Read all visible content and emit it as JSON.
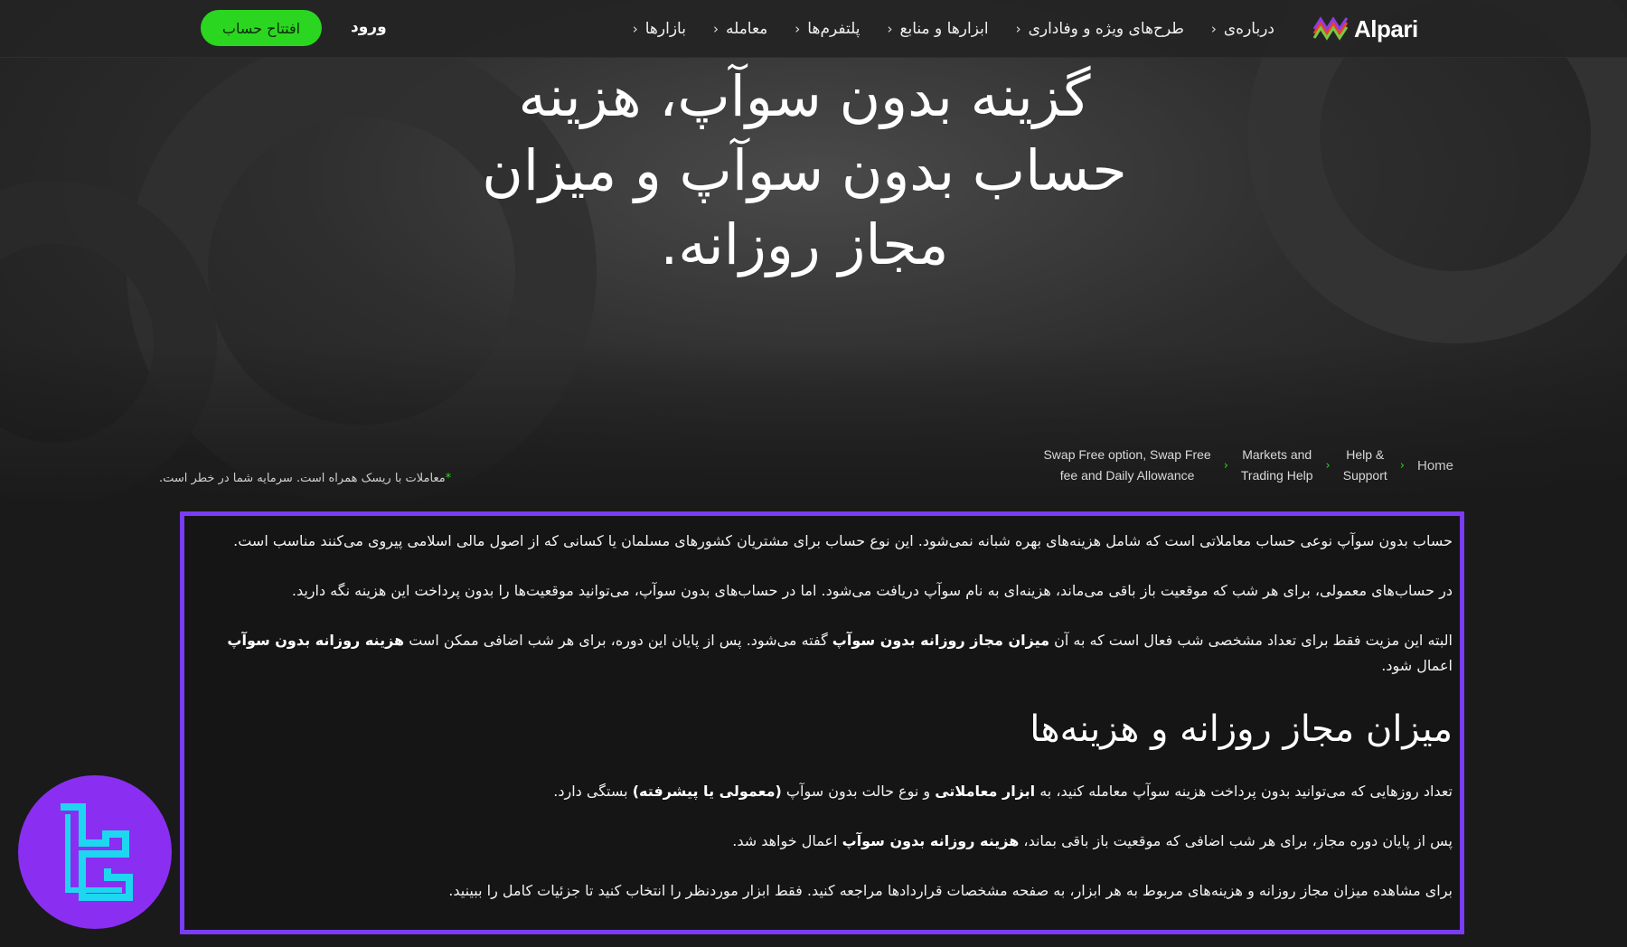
{
  "brand": {
    "name": "Alpari"
  },
  "nav": {
    "items": [
      {
        "label": "بازارها"
      },
      {
        "label": "معامله"
      },
      {
        "label": "پلتفرم‌ها"
      },
      {
        "label": "ابزارها و منابع"
      },
      {
        "label": "طرح‌های ویژه و وفاداری"
      },
      {
        "label": "درباره‌ی"
      }
    ],
    "chevron": "‹",
    "login": "ورود",
    "open_account": "افتتاح حساب"
  },
  "hero": {
    "title_line1": "گزینه بدون سوآپ، هزینه",
    "title_line2": "حساب بدون سوآپ و میزان",
    "title_line3": "مجاز روزانه."
  },
  "breadcrumb": {
    "sep": "›",
    "items": [
      {
        "label": "Home"
      },
      {
        "line1": "Help &",
        "line2": "Support"
      },
      {
        "line1": "Markets and",
        "line2": "Trading Help"
      },
      {
        "line1": "Swap Free option, Swap Free",
        "line2": "fee and Daily Allowance"
      }
    ]
  },
  "risk_note": {
    "star": "*",
    "text": "معاملات با ریسک همراه است. سرمایه شما در خطر است."
  },
  "content": {
    "p1": "حساب بدون سوآپ نوعی حساب معاملاتی است که شامل هزینه‌های بهره شبانه نمی‌شود. این نوع حساب برای مشتریان کشورهای مسلمان یا کسانی که از اصول مالی اسلامی پیروی می‌کنند مناسب است.",
    "p2": "در حساب‌های معمولی، برای هر شب که موقعیت باز باقی می‌ماند، هزینه‌ای به نام سوآپ دریافت می‌شود. اما در حساب‌های بدون سوآپ، می‌توانید موقعیت‌ها را بدون پرداخت این هزینه نگه دارید.",
    "p3": {
      "a": "البته این مزیت فقط برای تعداد مشخصی شب فعال است که به آن ",
      "b1": "میزان مجاز روزانه بدون سوآپ",
      "c": " گفته می‌شود. پس از پایان این دوره، برای هر شب اضافی ممکن است ",
      "b2": "هزینه روزانه بدون سوآپ",
      "d": " اعمال شود."
    },
    "heading": "میزان مجاز روزانه و هزینه‌ها",
    "p4": {
      "a": "تعداد روزهایی که می‌توانید بدون پرداخت هزینه سوآپ معامله کنید، به ",
      "b1": "ابزار معاملاتی",
      "c": " و نوع حالت بدون سوآپ ",
      "d": "(",
      "b2": "معمولی",
      "e": " یا ",
      "b3": "پیشرفته",
      "f": ")",
      "g": " بستگی دارد."
    },
    "p5": {
      "a": "پس از پایان دوره مجاز، برای هر شب اضافی که موقعیت باز باقی بماند، ",
      "b1": "هزینه روزانه بدون سوآپ",
      "c": " اعمال خواهد شد."
    },
    "p6": "برای مشاهده میزان مجاز روزانه و هزینه‌های مربوط به هر ابزار، به صفحه مشخصات قراردادها مراجعه کنید. فقط ابزار موردنظر را انتخاب کنید تا جزئیات کامل را ببینید."
  },
  "colors": {
    "accent": "#7a3cf5",
    "green": "#2bd620",
    "badge": "#8a2ff2",
    "badge_mark": "#1fd6f0"
  },
  "icons": {
    "logo": "alpari-logo-icon",
    "badge": "tf-logo-icon",
    "chevron": "chevron-left-icon"
  }
}
